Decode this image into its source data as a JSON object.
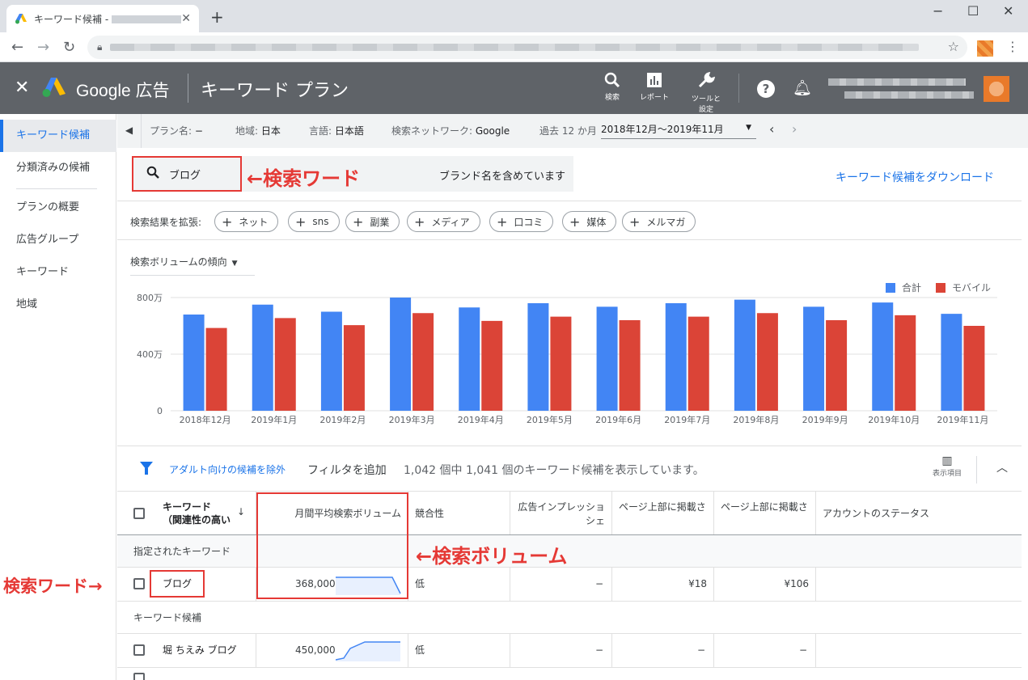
{
  "browser": {
    "tab_title": "キーワード候補 -",
    "new_tab": "+",
    "win_min": "−",
    "win_max": "☐",
    "win_close": "✕"
  },
  "header": {
    "brand": "Google 広告",
    "page_title": "キーワード プラン",
    "search_label": "検索",
    "reports_label": "レポート",
    "tools_label_1": "ツールと",
    "tools_label_2": "設定",
    "help": "?"
  },
  "sidebar": {
    "items": [
      {
        "label": "キーワード候補"
      },
      {
        "label": "分類済みの候補"
      },
      {
        "label": "プランの概要"
      },
      {
        "label": "広告グループ"
      },
      {
        "label": "キーワード"
      },
      {
        "label": "地域"
      }
    ]
  },
  "planbar": {
    "plan_name_label": "プラン名: ",
    "plan_name_value": "−",
    "region_label": "地域: ",
    "region_value": "日本",
    "lang_label": "言語: ",
    "lang_value": "日本語",
    "network_label": "検索ネットワーク: ",
    "network_value": "Google",
    "period_label": "過去 12 か月",
    "date_range": "2018年12月～2019年11月"
  },
  "search": {
    "keyword": "ブログ",
    "brand_text": "ブランド名を含めています",
    "download": "キーワード候補をダウンロード",
    "annotation": "←検索ワード"
  },
  "expand": {
    "label": "検索結果を拡張:",
    "chips": [
      "ネット",
      "sns",
      "副業",
      "メディア",
      "口コミ",
      "媒体",
      "メルマガ"
    ]
  },
  "chart_panel": {
    "dropdown": "検索ボリュームの傾向"
  },
  "chart_data": {
    "type": "bar",
    "categories": [
      "2018年12月",
      "2019年1月",
      "2019年2月",
      "2019年3月",
      "2019年4月",
      "2019年5月",
      "2019年6月",
      "2019年7月",
      "2019年8月",
      "2019年9月",
      "2019年10月",
      "2019年11月"
    ],
    "series": [
      {
        "name": "合計",
        "color": "#4285f4",
        "values": [
          680,
          750,
          700,
          800,
          730,
          760,
          735,
          760,
          785,
          735,
          765,
          685
        ]
      },
      {
        "name": "モバイル",
        "color": "#db4437",
        "values": [
          585,
          655,
          605,
          690,
          635,
          665,
          640,
          665,
          690,
          640,
          675,
          600
        ]
      }
    ],
    "y_ticks": [
      0,
      400,
      800
    ],
    "y_tick_labels": [
      "0",
      "400万",
      "800万"
    ],
    "ylim": [
      0,
      800
    ],
    "unit": "万",
    "legend_position": "top-right",
    "grid": true
  },
  "table": {
    "adult_filter": "アダルト向けの候補を除外",
    "add_filter": "フィルタを追加",
    "count_text": "1,042 個中 1,041 個のキーワード候補を表示しています。",
    "columns_label": "表示項目",
    "headers": {
      "keyword_1": "キーワード",
      "keyword_2": "（関連性の高い",
      "sort": "↓",
      "volume": "月間平均検索ボリューム",
      "competition": "競合性",
      "impression_1": "広告インプレッショ",
      "impression_2": "シェ",
      "low_bid": "ページ上部に掲載さ",
      "high_bid": "ページ上部に掲載さ",
      "status": "アカウントのステータス"
    },
    "section_specified": "指定されたキーワード",
    "section_ideas": "キーワード候補",
    "rows": [
      {
        "keyword": "ブログ",
        "volume": "368,000",
        "competition": "低",
        "impression": "−",
        "low_bid": "¥18",
        "high_bid": "¥106"
      },
      {
        "keyword": "堀 ちえみ ブログ",
        "volume": "450,000",
        "competition": "低",
        "impression": "−",
        "low_bid": "−",
        "high_bid": "−"
      }
    ],
    "annotation_volume": "←検索ボリューム",
    "annotation_keyword": "検索ワード→"
  }
}
